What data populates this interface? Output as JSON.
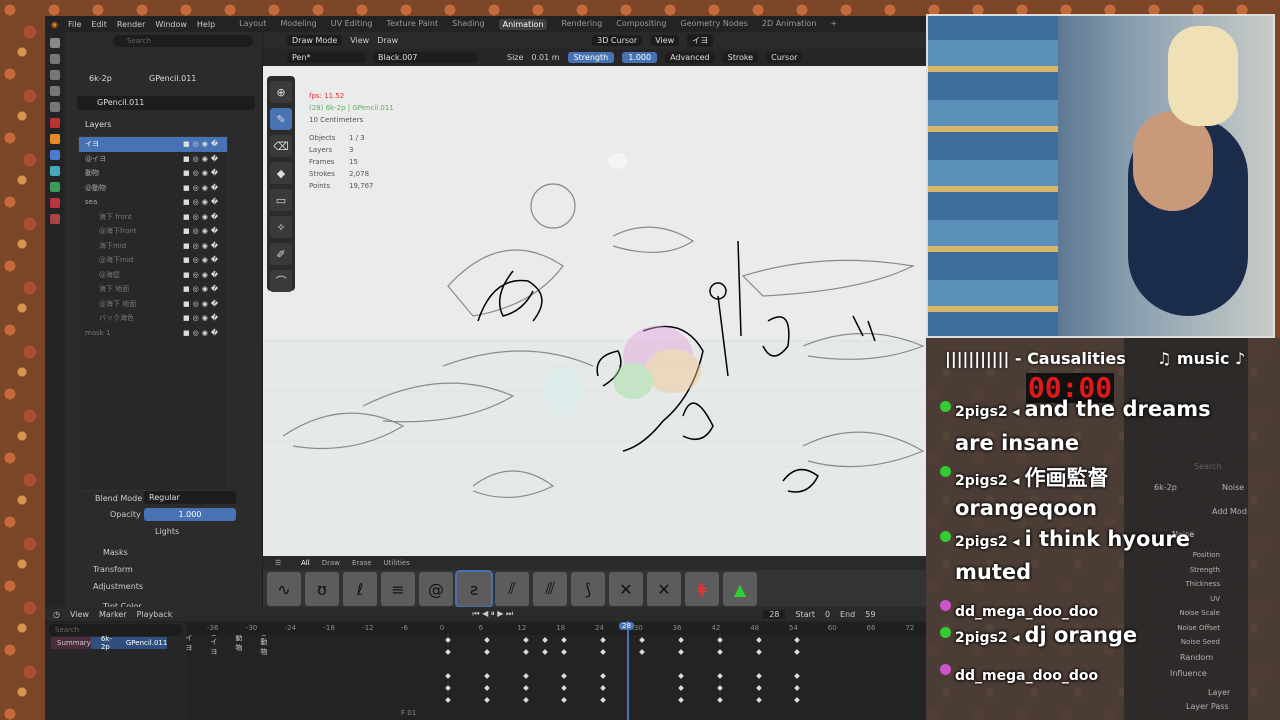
{
  "topbar": {
    "menus": [
      "File",
      "Edit",
      "Render",
      "Window",
      "Help"
    ],
    "workspaces": [
      "Layout",
      "Modeling",
      "UV Editing",
      "Texture Paint",
      "Shading",
      "Animation",
      "Rendering",
      "Compositing",
      "Geometry Nodes",
      "2D Animation"
    ],
    "active_workspace": "Animation",
    "add": "+"
  },
  "props": {
    "search_placeholder": "Search",
    "object": "6k-2p",
    "data": "GPencil.011",
    "data_field": "GPencil.011",
    "layers_title": "Layers",
    "blend_mode_label": "Blend Mode",
    "blend_mode": "Regular",
    "opacity_label": "Opacity",
    "opacity": "1.000",
    "lights": "Lights",
    "masks": "Masks",
    "transform": "Transform",
    "adjustments": "Adjustments",
    "tint": "Tint Color"
  },
  "layers": [
    {
      "name": "イヨ",
      "sel": true
    },
    {
      "name": "@イヨ"
    },
    {
      "name": "動物"
    },
    {
      "name": "@動物"
    },
    {
      "name": "sea"
    },
    {
      "name": "海下 front"
    },
    {
      "name": "@海下front"
    },
    {
      "name": "海下mid"
    },
    {
      "name": "@海下mid"
    },
    {
      "name": "@海壁"
    },
    {
      "name": "海下 地面"
    },
    {
      "name": "@海下 地面"
    },
    {
      "name": "バック海色"
    },
    {
      "name": "mask 1"
    }
  ],
  "viewport": {
    "mode": "Draw Mode",
    "view": "View",
    "draw": "Draw",
    "cursor3d": "3D Cursor",
    "view2": "View",
    "ie": "イヨ",
    "brush": "Pen*",
    "material": "Black.007",
    "size_label": "Size",
    "size": "0.01 m",
    "strength_label": "Strength",
    "strength": "1.000",
    "advanced": "Advanced",
    "stroke": "Stroke",
    "cursor": "Cursor",
    "fps": "fps: 11.52",
    "context": "(28) 6k-2p | GPencil.011",
    "units": "10 Centimeters",
    "stats": [
      [
        "Objects",
        "1 / 3"
      ],
      [
        "Layers",
        "3"
      ],
      [
        "Frames",
        "15"
      ],
      [
        "Strokes",
        "2,078"
      ],
      [
        "Points",
        "19,767"
      ]
    ]
  },
  "brush_tabs": [
    "All",
    "Draw",
    "Erase",
    "Utilities"
  ],
  "timeline": {
    "view": "View",
    "marker": "Marker",
    "playback": "Playback",
    "frame": "28",
    "start_label": "Start",
    "start": "0",
    "end_label": "End",
    "end": "59",
    "search_placeholder": "Search",
    "nums": [
      "-36",
      "-30",
      "-24",
      "-18",
      "-12",
      "-6",
      "0",
      "6",
      "12",
      "18",
      "24",
      "30",
      "36",
      "42",
      "48",
      "54",
      "60",
      "66",
      "72"
    ],
    "playhead": "28",
    "channels": [
      "Summary",
      "6k-2p",
      "GPencil.011",
      "イヨ",
      "@イヨ",
      "動物",
      "@動物"
    ],
    "footer": "F 01"
  },
  "overlay": {
    "song": "||||||||||| - Causalities",
    "music": "♫ music ♪",
    "timer": "00:00",
    "chat": [
      {
        "user": "2pigs2",
        "msg": "and the dreams"
      },
      {
        "user": "",
        "msg": "are insane"
      },
      {
        "user": "2pigs2",
        "msg": "作画監督"
      },
      {
        "user": "",
        "msg": "orangeqoon"
      },
      {
        "user": "2pigs2",
        "msg": "i think hyoure"
      },
      {
        "user": "",
        "msg": "muted"
      },
      {
        "user": "dd_mega_doo_doo",
        "msg": ""
      },
      {
        "user": "2pigs2",
        "msg": "dj orange"
      },
      {
        "user": "dd_mega_doo_doo",
        "msg": ""
      }
    ]
  },
  "right_panel": {
    "object": "6k-2p",
    "modifier": "Noise",
    "add": "Add Mod",
    "noise": "Noise",
    "rows": [
      "Position",
      "Strength",
      "Thickness",
      "UV",
      "Noise Scale",
      "Noise Offset",
      "Noise Seed"
    ],
    "random": "Random",
    "influence": "Influence",
    "layer": "Layer",
    "layer_pass": "Layer Pass",
    "search": "Search"
  }
}
